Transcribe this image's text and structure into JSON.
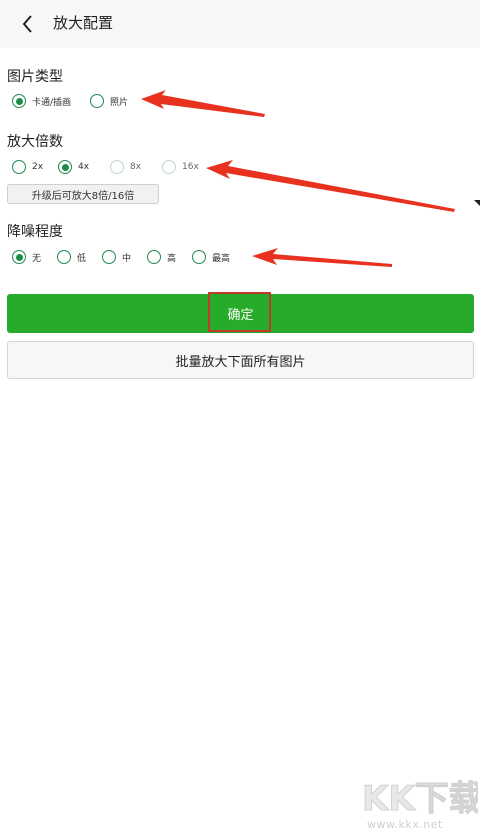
{
  "header": {
    "title": "放大配置"
  },
  "image_type": {
    "label": "图片类型",
    "options": [
      {
        "label": "卡通/插画",
        "checked": true
      },
      {
        "label": "照片",
        "checked": false
      }
    ]
  },
  "scale": {
    "label": "放大倍数",
    "options": [
      {
        "label": "2x",
        "checked": false
      },
      {
        "label": "4x",
        "checked": true
      },
      {
        "label": "8x",
        "checked": false,
        "disabled": true
      },
      {
        "label": "16x",
        "checked": false,
        "disabled": true
      }
    ],
    "upgrade_label": "升级后可放大8倍/16倍"
  },
  "denoise": {
    "label": "降噪程度",
    "options": [
      {
        "label": "无",
        "checked": true
      },
      {
        "label": "低",
        "checked": false
      },
      {
        "label": "中",
        "checked": false
      },
      {
        "label": "高",
        "checked": false
      },
      {
        "label": "最高",
        "checked": false
      }
    ]
  },
  "actions": {
    "confirm_label": "确定",
    "batch_label": "批量放大下面所有图片"
  },
  "watermark": {
    "logo_text": "KK下载",
    "url": "www.kkx.net"
  },
  "colors": {
    "accent_green": "#26ac2a",
    "radio_green": "#1e8b4b",
    "annotation_red": "#e8321f"
  }
}
